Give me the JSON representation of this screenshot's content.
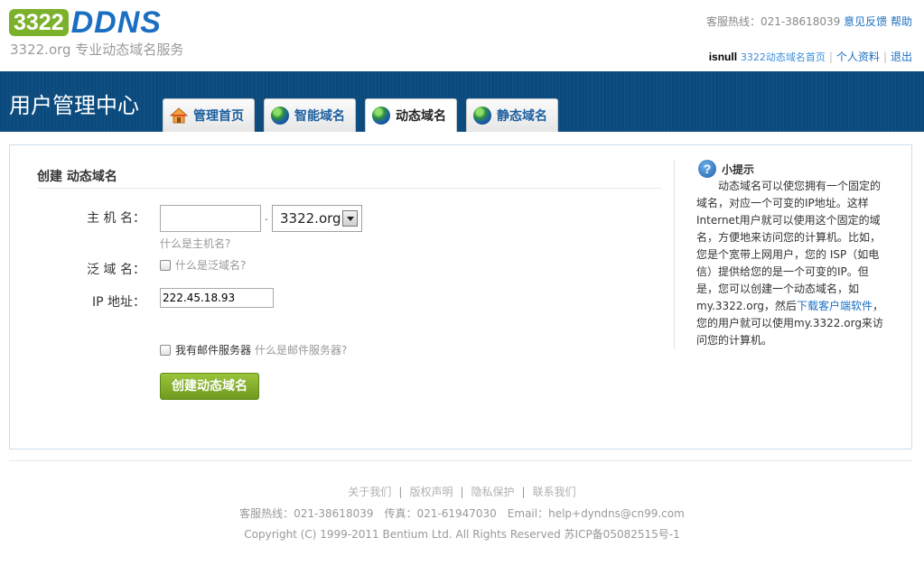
{
  "header": {
    "logo_num": "3322",
    "logo_ddns": "DDNS",
    "tagline": "3322.org 专业动态域名服务",
    "hotline_label": "客服热线：021-38618039",
    "feedback_link": "意见反馈",
    "help_link": "帮助",
    "username": "isnull",
    "portal_link": "3322动态域名首页",
    "profile_link": "个人资料",
    "logout_link": "退出"
  },
  "nav": {
    "title": "用户管理中心",
    "tabs": [
      {
        "label": "管理首页",
        "icon": "home-icon"
      },
      {
        "label": "智能域名",
        "icon": "globe-icon"
      },
      {
        "label": "动态域名",
        "icon": "globe-icon",
        "active": true
      },
      {
        "label": "静态域名",
        "icon": "globe-icon"
      }
    ]
  },
  "form": {
    "title": "创建 动态域名",
    "hostname_label": "主 机 名：",
    "hostname_value": "",
    "dot": ".",
    "domain_selected": "3322.org",
    "hostname_help": "什么是主机名?",
    "wildcard_label": "泛 域 名：",
    "wildcard_help": "什么是泛域名?",
    "ip_label": "IP 地址：",
    "ip_value": "222.45.18.93",
    "mailserver_label": "我有邮件服务器",
    "mailserver_help": "什么是邮件服务器?",
    "submit_label": "创建动态域名"
  },
  "tip": {
    "icon": "question-icon",
    "title": "小提示",
    "lines": [
      "　　动态域名可以使您拥有一个固定的",
      "域名，对应一个可变的IP地址。这样",
      "Internet用户就可以使用这个固定的域",
      "名，方便地来访问您的计算机。比如，",
      "您是个宽带上网用户，您的 ISP（如电",
      "信）提供给您的是一个可变的IP。但",
      "是，您可以创建一个动态域名，如"
    ],
    "line8_prefix": "my.3322.org，然后",
    "download_link": "下载客户端软件",
    "line8_suffix": "，",
    "line9": "您的用户就可以使用my.3322.org来访",
    "line10": "问您的计算机。"
  },
  "footer": {
    "links": [
      "关于我们",
      "版权声明",
      "隐私保护",
      "联系我们"
    ],
    "contact": "客服热线：021-38618039　传真：021-61947030　Email：help+dyndns@cn99.com",
    "copyright": "Copyright (C) 1999-2011 Bentium Ltd. All Rights Reserved 苏ICP备05082515号-1"
  },
  "colors": {
    "brand_blue": "#1a6fc2",
    "brand_green": "#7cb12c",
    "nav_bar": "#0d4a7c",
    "button_green": "#7ea828"
  }
}
